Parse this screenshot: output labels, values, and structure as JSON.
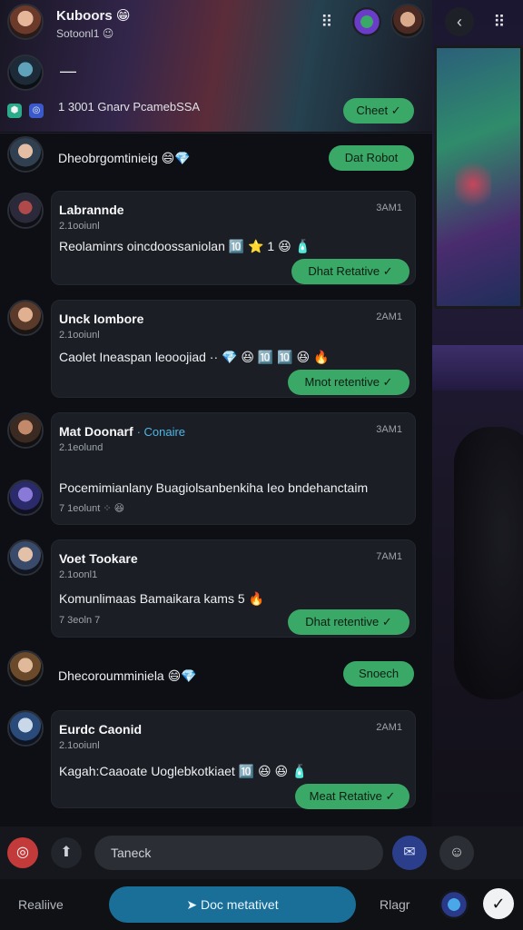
{
  "colors": {
    "accent_green": "#3aa867",
    "primary_blue": "#1a6f98",
    "card_bg": "#1b1e24"
  },
  "header": {
    "title": "Kuboors 😁",
    "subtitle": "Sotoonl1 😉",
    "icons": [
      "grid-icon",
      "gamepad-icon",
      "profile-avatar",
      "back-icon",
      "menu-icon"
    ]
  },
  "pinned": {
    "dash": "—",
    "text": "1 3001 Gnarv PcamebSSA",
    "button": "Cheet ✓"
  },
  "rows": [
    {
      "text": "Dheobrgomtinieig 😄💎",
      "button": "Dat Robot"
    },
    {
      "text": "Dhecoroumminiela 😄💎",
      "button": "Snoech"
    }
  ],
  "cards": [
    {
      "name": "Labrannde",
      "time": "3AM1",
      "sub": "2.1ooiunl",
      "body": "Reolaminrs oincdoossaniolan 🔟 ⭐ 1 😆 🧴",
      "button": "Dhat Retative ✓"
    },
    {
      "name": "Unck Iombore",
      "time": "2AM1",
      "sub": "2.1ooiunl",
      "body": "Caolet Ineaspan leooojiad ·· 💎 😆 🔟 🔟 😆 🔥",
      "button": "Mnot retentive ✓"
    },
    {
      "name": "Mat Doonarf",
      "verified": "· Conaire",
      "time": "3AM1",
      "sub": "2.1eolund",
      "body": "Pocemimianlany Buagiolsanbenkiha Ieo bndehanctaim",
      "body2": "7 1eolunt ⁘ 😆",
      "button": ""
    },
    {
      "name": "Voet Tookare",
      "time": "7AM1",
      "sub": "2.1oonl1",
      "body": "Komunlimaas Bamaikara kams 5 🔥",
      "body2": "7 3eoln 7",
      "button": "Dhat retentive ✓"
    },
    {
      "name": "Eurdc Caonid",
      "time": "2AM1",
      "sub": "2.1ooiunl",
      "body": "Kagah:Caaoate Uoglebkotkiaet 🔟 😆 😆 🧴",
      "button": "Meat Retative ✓"
    }
  ],
  "composer": {
    "placeholder": "Taneck"
  },
  "bottom_nav": {
    "left": "Realiive",
    "primary": "Doc metativet",
    "right": "Rlagr"
  }
}
